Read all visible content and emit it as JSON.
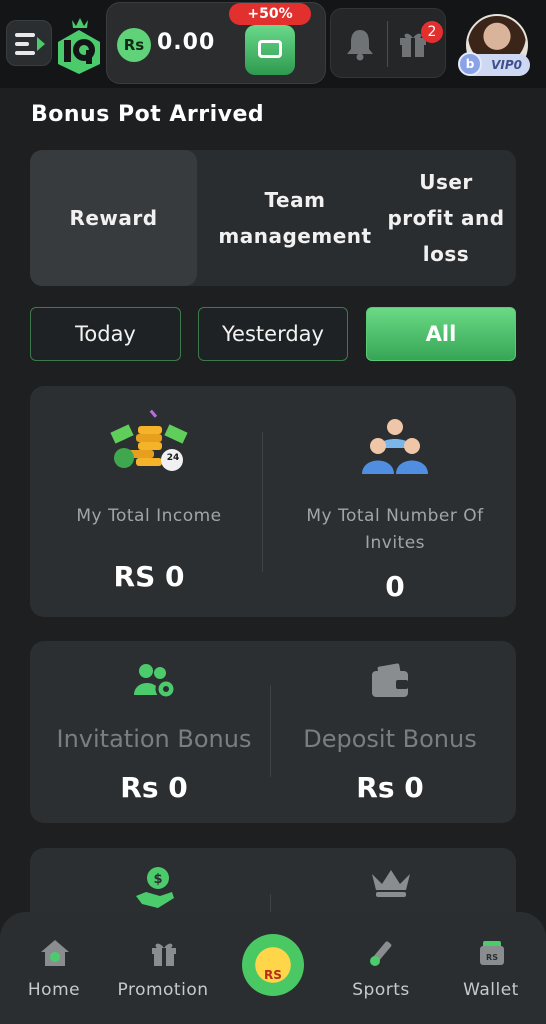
{
  "header": {
    "currency_symbol": "Rs",
    "balance": "0.00",
    "bonus_tag": "+50%",
    "gift_count": "2",
    "vip_label": "VIP0",
    "vip_letter": "b"
  },
  "page_title": "Bonus Pot Arrived",
  "tabs": [
    {
      "label": "Reward",
      "active": true
    },
    {
      "label": "Team management",
      "active": false
    },
    {
      "label": "User profit and loss",
      "active": false
    }
  ],
  "filters": [
    {
      "label": "Today",
      "active": false
    },
    {
      "label": "Yesterday",
      "active": false
    },
    {
      "label": "All",
      "active": true
    }
  ],
  "summary": {
    "income_label": "My Total Income",
    "income_value": "RS 0",
    "invites_label": "My Total Number Of Invites",
    "invites_value": "0",
    "income_badge": "24"
  },
  "bonuses": {
    "invitation_label": "Invitation Bonus",
    "invitation_value": "Rs 0",
    "deposit_label": "Deposit Bonus",
    "deposit_value": "Rs 0"
  },
  "bottom_nav": [
    {
      "label": "Home",
      "icon": "home-icon"
    },
    {
      "label": "Promotion",
      "icon": "gift-icon"
    },
    {
      "label": "RS",
      "icon": "money-bag-icon"
    },
    {
      "label": "Sports",
      "icon": "cricket-icon"
    },
    {
      "label": "Wallet",
      "icon": "wallet-icon"
    }
  ],
  "colors": {
    "accent": "#4ccb6c",
    "background": "#1d1f20",
    "card": "#2c2f31",
    "badge": "#e2302f"
  }
}
